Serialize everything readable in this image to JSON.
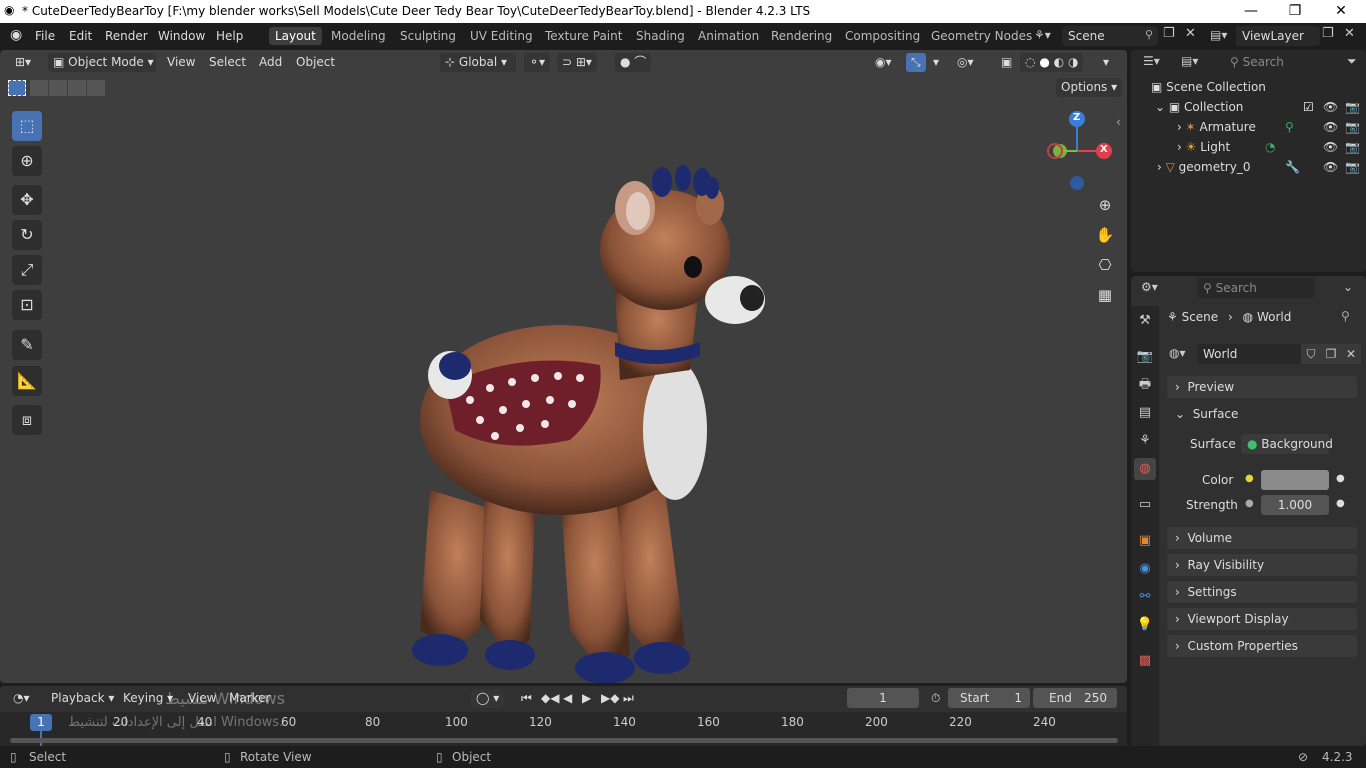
{
  "window": {
    "title": "* CuteDeerTedyBearToy [F:\\my blender works\\Sell Models\\Cute Deer Tedy Bear Toy\\CuteDeerTedyBearToy.blend] - Blender 4.2.3 LTS",
    "minimize": "—",
    "maximize": "❐",
    "close": "✕"
  },
  "menu": [
    "File",
    "Edit",
    "Render",
    "Window",
    "Help"
  ],
  "workspaces": [
    "Layout",
    "Modeling",
    "Sculpting",
    "UV Editing",
    "Texture Paint",
    "Shading",
    "Animation",
    "Rendering",
    "Compositing",
    "Geometry Nodes"
  ],
  "active_workspace": "Layout",
  "scene_selector": "Scene",
  "viewlayer_selector": "ViewLayer",
  "viewport": {
    "mode": "Object Mode",
    "menus": [
      "View",
      "Select",
      "Add",
      "Object"
    ],
    "transform_orientation": "Global",
    "options": "Options",
    "gizmo": {
      "z": "Z",
      "x": "X"
    }
  },
  "outliner": {
    "search_placeholder": "Search",
    "scene_collection": "Scene Collection",
    "items": [
      {
        "label": "Collection"
      },
      {
        "label": "Armature"
      },
      {
        "label": "Light"
      },
      {
        "label": "geometry_0"
      }
    ]
  },
  "properties": {
    "search_placeholder": "Search",
    "breadcrumb": [
      "Scene",
      "World"
    ],
    "world_name": "World",
    "panels": {
      "preview": "Preview",
      "surface": "Surface",
      "volume": "Volume",
      "ray_visibility": "Ray Visibility",
      "settings": "Settings",
      "viewport_display": "Viewport Display",
      "custom_properties": "Custom Properties"
    },
    "surface_label": "Surface",
    "surface_value": "Background",
    "color_label": "Color",
    "color_value": "#8a8a8a",
    "strength_label": "Strength",
    "strength_value": "1.000"
  },
  "timeline": {
    "menus": [
      "Playback",
      "Keying",
      "View",
      "Marker"
    ],
    "current_frame": "1",
    "start_label": "Start",
    "start_value": "1",
    "end_label": "End",
    "end_value": "250",
    "ticks": [
      "1",
      "20",
      "40",
      "60",
      "80",
      "100",
      "120",
      "140",
      "160",
      "180",
      "200",
      "220",
      "240"
    ]
  },
  "watermark": {
    "line1": "تنشيط Windows",
    "line2": "انتقل إلى الإعدادات لتنشيط Windows."
  },
  "statusbar": {
    "select": "Select",
    "rotate": "Rotate View",
    "object": "Object",
    "version": "4.2.3"
  },
  "colors": {
    "accent": "#4772b3",
    "viewport_bg": "#3e3e3e",
    "gizmo_x": "#e0404d",
    "gizmo_y": "#7fbf3f",
    "gizmo_z": "#3b7ed8",
    "frame_marker": "#4772b3"
  }
}
